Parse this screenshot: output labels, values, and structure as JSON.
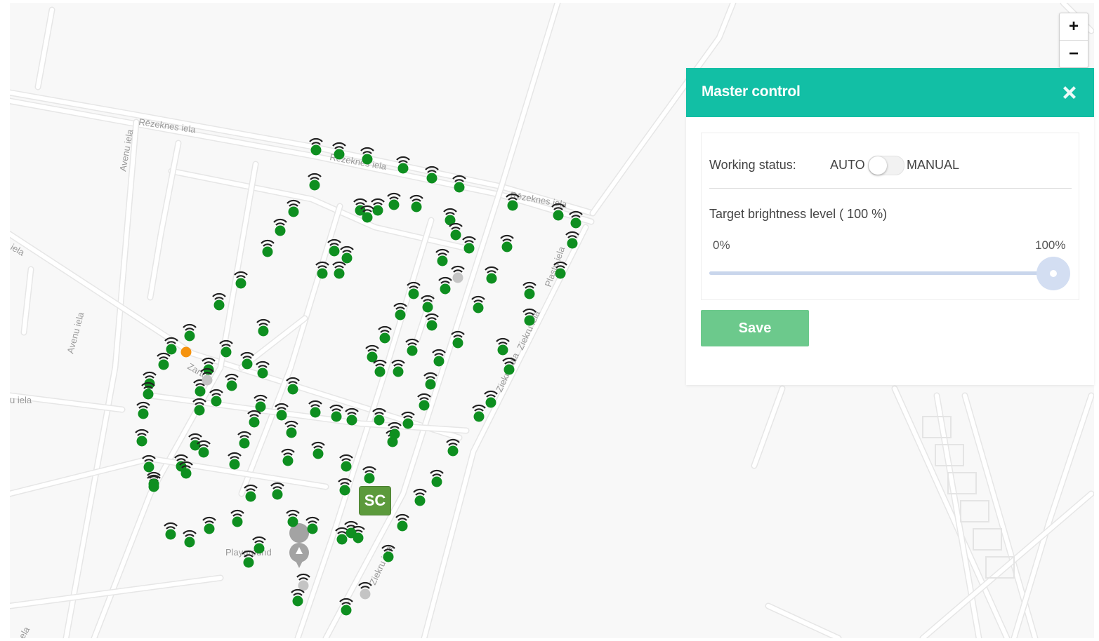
{
  "map": {
    "streets": [
      "Rēzeknes iela",
      "Rēzeknes iela",
      "Rēzeknes iela",
      "Avenu iela",
      "Avenu iela",
      "iela",
      "u iela",
      "Plastu iela",
      "Ziekru iela",
      "Ziekru iela",
      "Zartu",
      "Ziekru iela",
      "ela",
      "Playground"
    ],
    "sc_label": "SC",
    "colors": {
      "online": "#0e8f20",
      "offline": "#c4c4c4",
      "warning": "#f5930f"
    }
  },
  "zoom": {
    "in_label": "+",
    "out_label": "−"
  },
  "panel": {
    "title": "Master control",
    "working_status_label": "Working status:",
    "auto_label": "AUTO",
    "manual_label": "MANUAL",
    "brightness_label": "Target brightness level ( 100 %)",
    "min_label": "0%",
    "max_label": "100%",
    "brightness_value": 100,
    "save_label": "Save",
    "accent": "#12bfa5"
  }
}
